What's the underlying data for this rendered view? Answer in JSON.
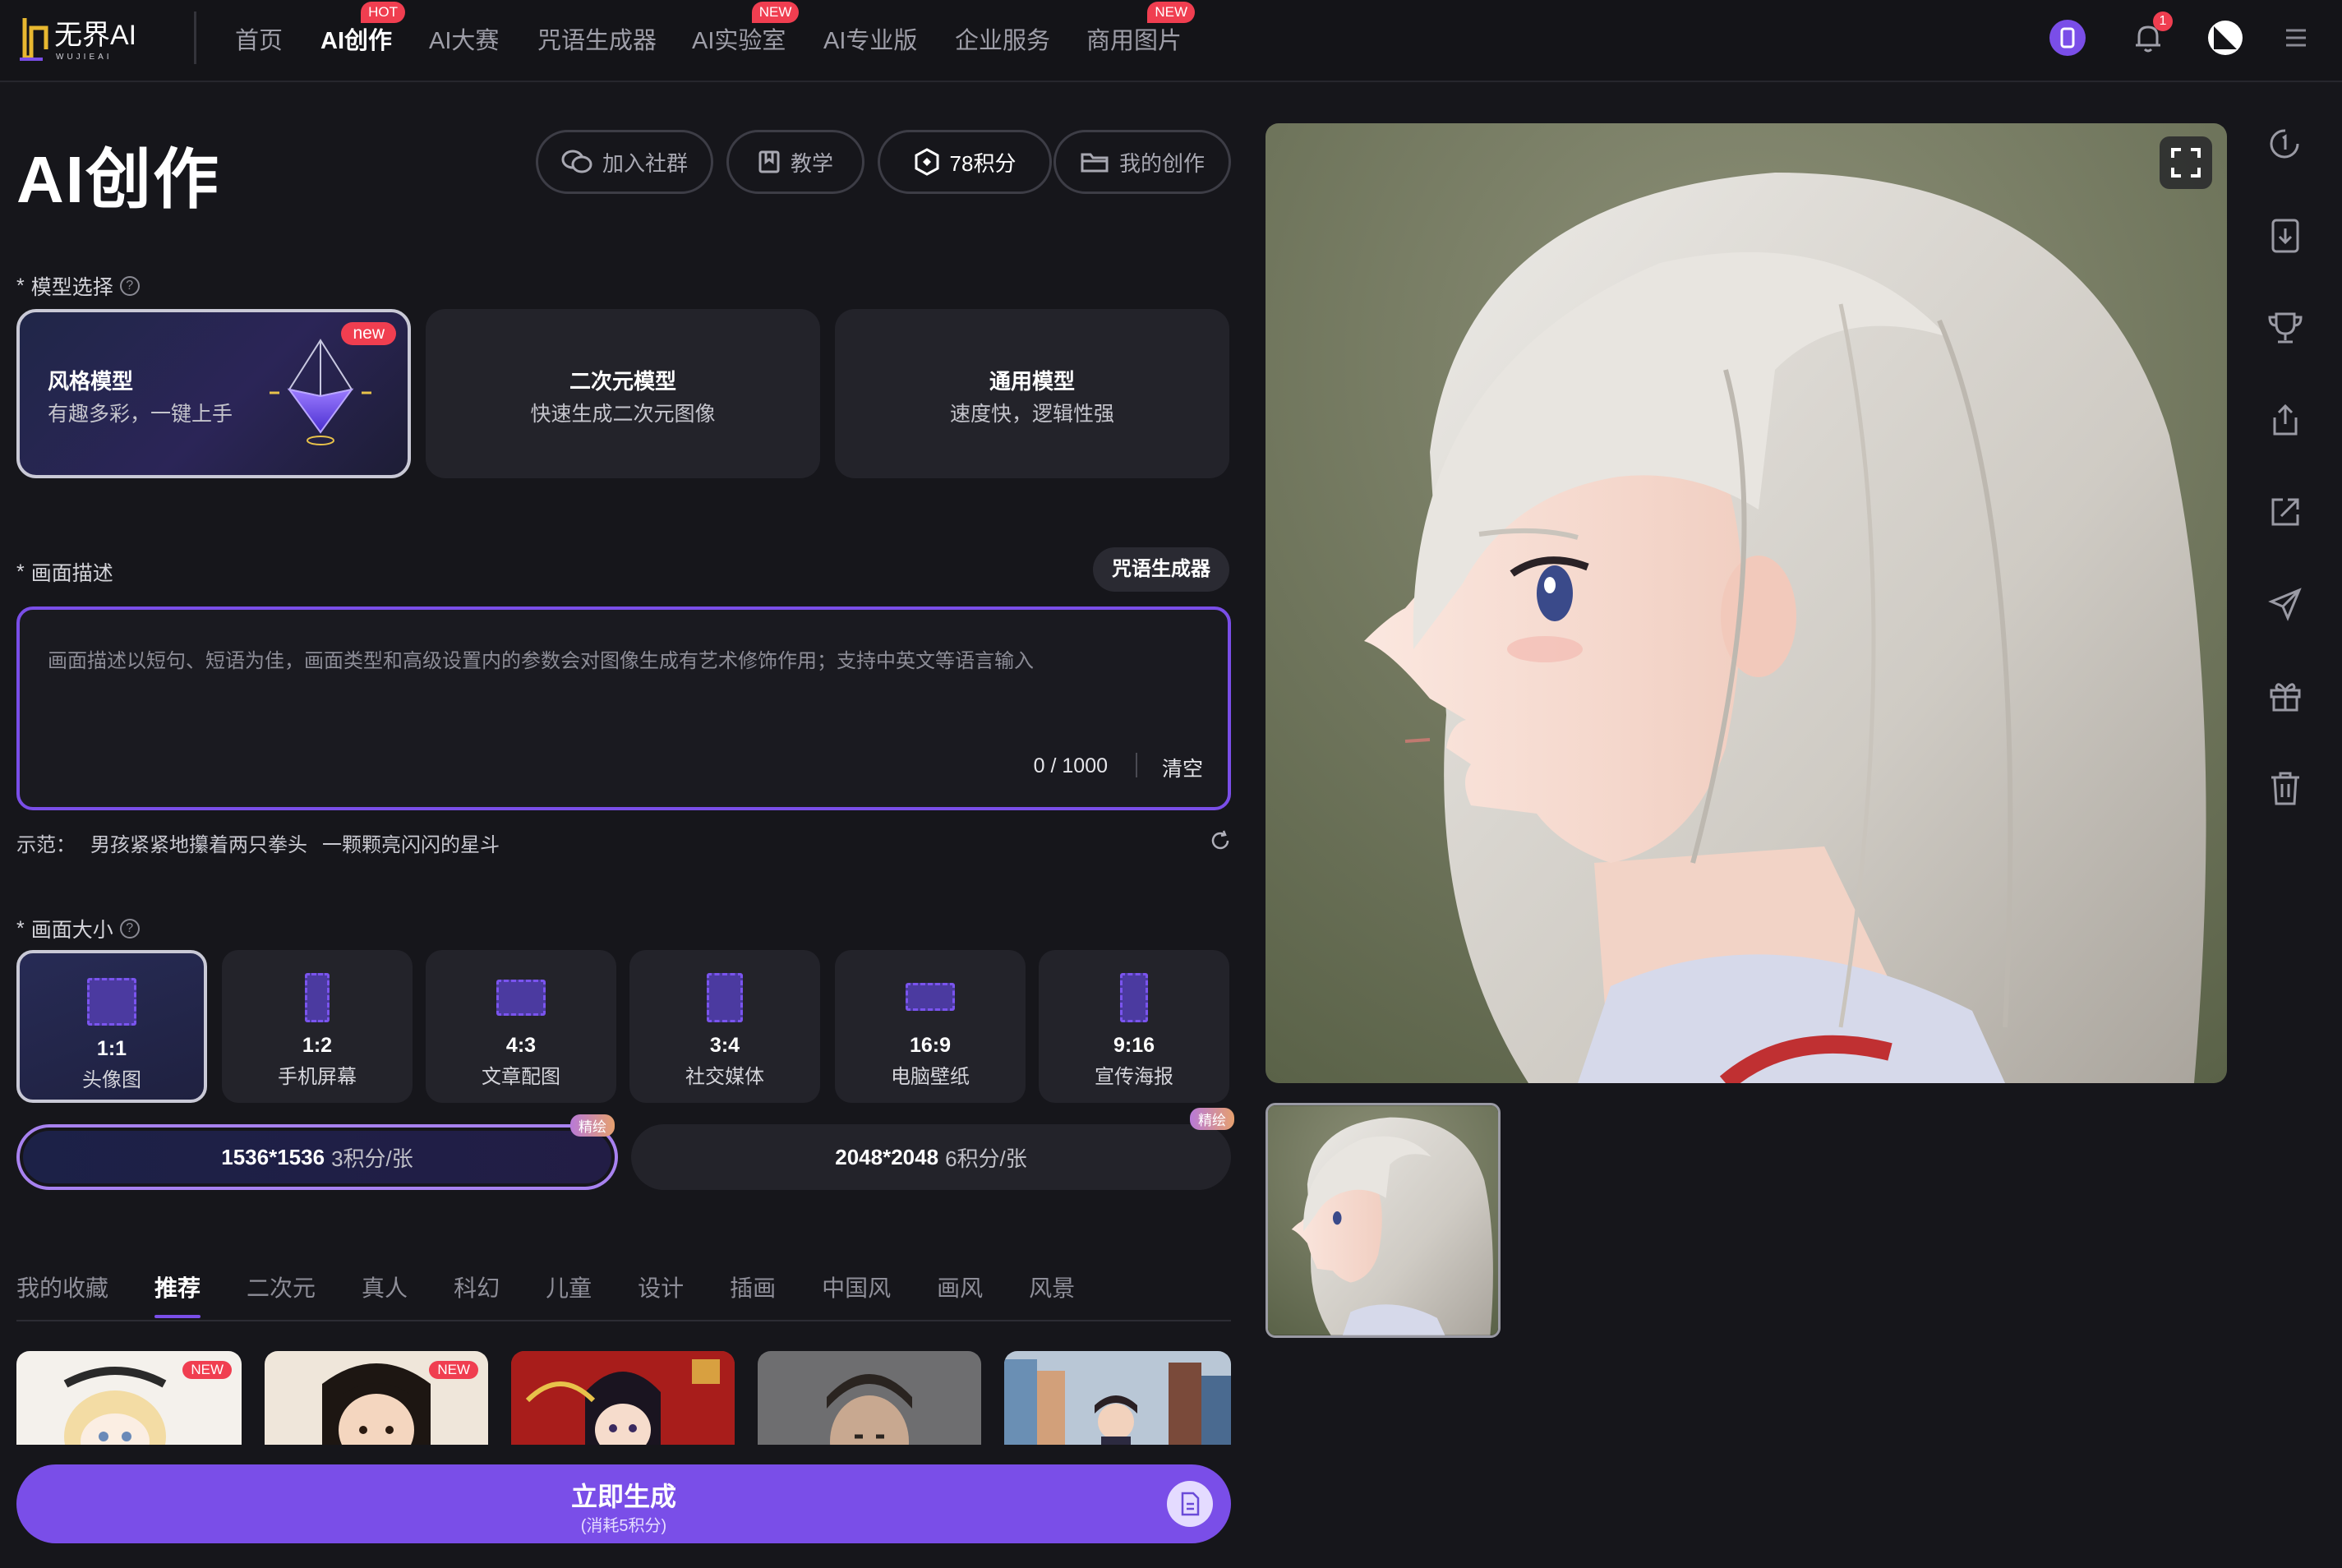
{
  "nav": {
    "logo_text": "无界AI",
    "logo_subtext": "WUJIEAI",
    "items": [
      {
        "label": "首页",
        "badge": ""
      },
      {
        "label": "AI创作",
        "badge": "HOT"
      },
      {
        "label": "AI大赛",
        "badge": ""
      },
      {
        "label": "咒语生成器",
        "badge": ""
      },
      {
        "label": "AI实验室",
        "badge": "NEW"
      },
      {
        "label": "AI专业版",
        "badge": ""
      },
      {
        "label": "企业服务",
        "badge": ""
      },
      {
        "label": "商用图片",
        "badge": "NEW"
      }
    ],
    "notification_count": "1",
    "accent_color": "#7a4ee8",
    "badge_color": "#f03e50"
  },
  "header": {
    "title": "AI创作",
    "buttons": {
      "join_group": "加入社群",
      "tutorial": "教学",
      "points": "78积分",
      "my_creations": "我的创作"
    }
  },
  "model": {
    "label": "模型选择",
    "required_mark": "*",
    "options": [
      {
        "title": "风格模型",
        "subtitle": "有趣多彩，一键上手",
        "tag": "new",
        "selected": true
      },
      {
        "title": "二次元模型",
        "subtitle": "快速生成二次元图像",
        "tag": "",
        "selected": false
      },
      {
        "title": "通用模型",
        "subtitle": "速度快，逻辑性强",
        "tag": "",
        "selected": false
      }
    ]
  },
  "prompt": {
    "label": "画面描述",
    "required_mark": "*",
    "spell_button": "咒语生成器",
    "placeholder": "画面描述以短句、短语为佳，画面类型和高级设置内的参数会对图像生成有艺术修饰作用；支持中英文等语言输入",
    "counter": "0 / 1000",
    "clear_label": "清空",
    "example_label": "示范：",
    "examples": [
      "男孩紧紧地攥着两只拳头",
      "一颗颗亮闪闪的星斗"
    ]
  },
  "size": {
    "label": "画面大小",
    "required_mark": "*",
    "options": [
      {
        "ratio": "1:1",
        "usage": "头像图",
        "selected": true
      },
      {
        "ratio": "1:2",
        "usage": "手机屏幕",
        "selected": false
      },
      {
        "ratio": "4:3",
        "usage": "文章配图",
        "selected": false
      },
      {
        "ratio": "3:4",
        "usage": "社交媒体",
        "selected": false
      },
      {
        "ratio": "16:9",
        "usage": "电脑壁纸",
        "selected": false
      },
      {
        "ratio": "9:16",
        "usage": "宣传海报",
        "selected": false
      }
    ],
    "resolutions": [
      {
        "value": "1536*1536",
        "cost": "3积分/张",
        "tag": "精绘",
        "selected": true
      },
      {
        "value": "2048*2048",
        "cost": "6积分/张",
        "tag": "精绘",
        "selected": false
      }
    ]
  },
  "styles": {
    "tabs": [
      "我的收藏",
      "推荐",
      "二次元",
      "真人",
      "科幻",
      "儿童",
      "设计",
      "插画",
      "中国风",
      "画风",
      "风景"
    ],
    "active_tab": "推荐",
    "thumbnails": [
      {
        "tag": "NEW"
      },
      {
        "tag": "NEW"
      },
      {
        "tag": ""
      },
      {
        "tag": ""
      },
      {
        "tag": ""
      }
    ]
  },
  "generate": {
    "label": "立即生成",
    "sub_label": "(消耗5积分)"
  },
  "sidebar_tools": [
    "history-icon",
    "download-icon",
    "trophy-icon",
    "share-icon",
    "export-icon",
    "send-icon",
    "gift-icon",
    "trash-icon"
  ]
}
